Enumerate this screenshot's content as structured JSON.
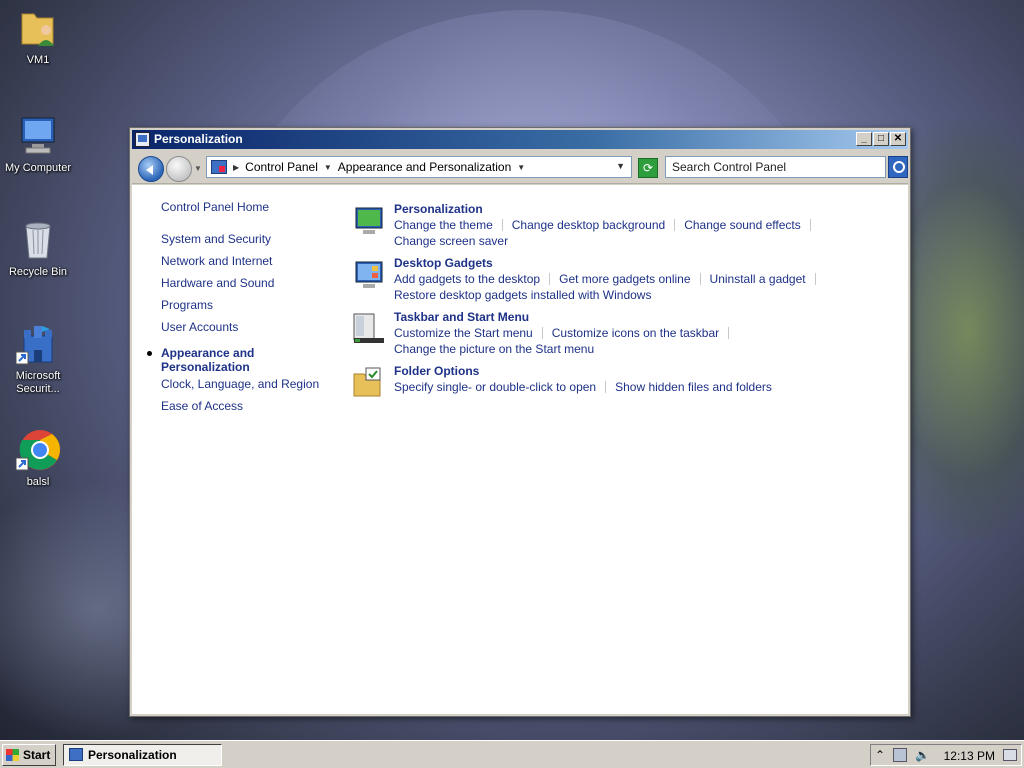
{
  "desktop": {
    "icons": [
      {
        "label": "VM1"
      },
      {
        "label": "My Computer"
      },
      {
        "label": "Recycle Bin"
      },
      {
        "label": "Microsoft Securit..."
      },
      {
        "label": "balsl"
      }
    ]
  },
  "window": {
    "title": "Personalization",
    "breadcrumbs": [
      "Control Panel",
      "Appearance and Personalization"
    ],
    "search_placeholder": "Search Control Panel"
  },
  "leftnav": {
    "home": "Control Panel Home",
    "items": [
      "System and Security",
      "Network and Internet",
      "Hardware and Sound",
      "Programs",
      "User Accounts",
      "Appearance and Personalization",
      "Clock, Language, and Region",
      "Ease of Access"
    ]
  },
  "categories": [
    {
      "title": "Personalization",
      "links": [
        "Change the theme",
        "Change desktop background",
        "Change sound effects",
        "Change screen saver"
      ]
    },
    {
      "title": "Desktop Gadgets",
      "links": [
        "Add gadgets to the desktop",
        "Get more gadgets online",
        "Uninstall a gadget",
        "Restore desktop gadgets installed with Windows"
      ]
    },
    {
      "title": "Taskbar and Start Menu",
      "links": [
        "Customize the Start menu",
        "Customize icons on the taskbar",
        "Change the picture on the Start menu"
      ]
    },
    {
      "title": "Folder Options",
      "links": [
        "Specify single- or double-click to open",
        "Show hidden files and folders"
      ]
    }
  ],
  "taskbar": {
    "start_label": "Start",
    "task_label": "Personalization",
    "clock": "12:13 PM"
  },
  "colors": {
    "link": "#1e3287",
    "titlebar_start": "#0a246a",
    "titlebar_end": "#a6caf0"
  }
}
